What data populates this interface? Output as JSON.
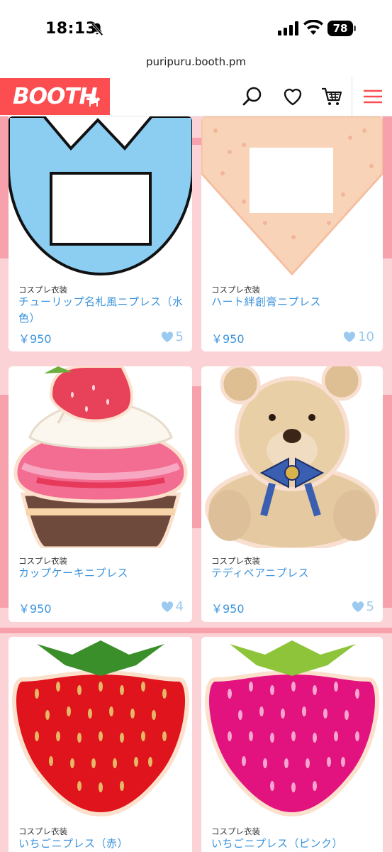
{
  "status": {
    "time": "18:13",
    "battery": "78"
  },
  "browser": {
    "url": "puripuru.booth.pm"
  },
  "header": {
    "logo_text": "BOOTH"
  },
  "products": [
    {
      "category": "コスプレ衣装",
      "title": "チューリップ名札風ニプレス（水色）",
      "price": "￥950",
      "likes": "5"
    },
    {
      "category": "コスプレ衣装",
      "title": "ハート絆創膏ニプレス",
      "price": "￥950",
      "likes": "10"
    },
    {
      "category": "コスプレ衣装",
      "title": "カップケーキニプレス",
      "price": "￥950",
      "likes": "4"
    },
    {
      "category": "コスプレ衣装",
      "title": "テディベアニプレス",
      "price": "￥950",
      "likes": "5"
    },
    {
      "category": "コスプレ衣装",
      "title": "いちごニプレス（赤）"
    },
    {
      "category": "コスプレ衣装",
      "title": "いちごニプレス（ピンク）"
    }
  ],
  "colors": {
    "brand": "#fc4d50",
    "link": "#3b93dd",
    "background": "#fbd3d7"
  }
}
